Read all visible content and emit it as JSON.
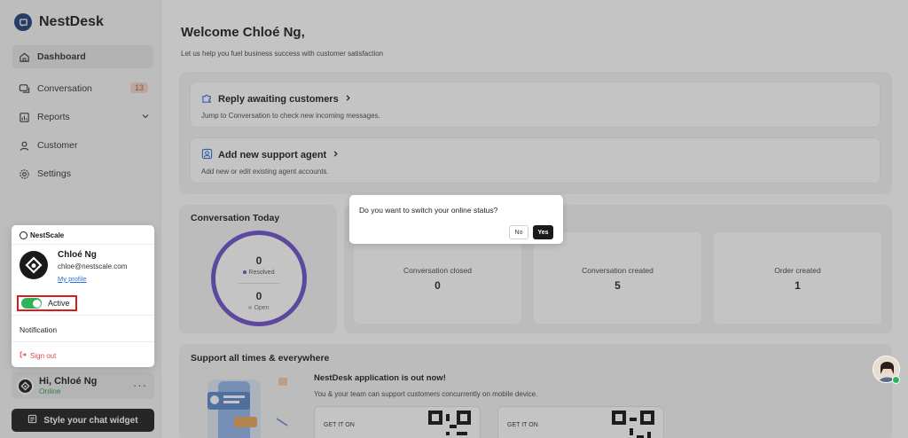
{
  "brand": {
    "name": "NestDesk"
  },
  "sidebar": {
    "items": [
      {
        "label": "Dashboard",
        "icon": "home-icon"
      },
      {
        "label": "Conversation",
        "icon": "chat-icon",
        "badge": "13"
      },
      {
        "label": "Reports",
        "icon": "report-icon"
      },
      {
        "label": "Customer",
        "icon": "user-icon"
      },
      {
        "label": "Settings",
        "icon": "gear-icon"
      }
    ],
    "profile": {
      "name": "Hi, Chloé Ng",
      "status": "Online",
      "more": "···"
    },
    "widget_button": "Style your chat widget"
  },
  "main": {
    "welcome": "Welcome Chloé Ng,",
    "subtitle": "Let us help you fuel business success with customer satisfaction",
    "quick": [
      {
        "title": "Reply awaiting customers",
        "desc": "Jump to Conversation to check new incoming messages."
      },
      {
        "title": "Add new support agent",
        "desc": "Add new or edit existing agent accounts."
      }
    ],
    "conversation_today": {
      "title": "Conversation Today",
      "resolved_value": "0",
      "resolved_label": "Resolved",
      "open_value": "0",
      "open_label": "Open"
    },
    "stats": [
      {
        "label": "Conversation closed",
        "value": "0"
      },
      {
        "label": "Conversation created",
        "value": "5"
      },
      {
        "label": "Order created",
        "value": "1"
      }
    ],
    "support": {
      "title": "Support all times & everywhere",
      "app_title": "NestDesk application is out now!",
      "app_desc": "You & your team can support customers concurrently on mobile device.",
      "store1": "GET IT ON",
      "store2": "GET IT ON"
    }
  },
  "dialog": {
    "question": "Do you want to switch your online status?",
    "no": "No",
    "yes": "Yes"
  },
  "popover": {
    "brand": "NestScale",
    "name": "Chloé Ng",
    "email": "chloe@nestscale.com",
    "profile_link": "My profile",
    "toggle_label": "Active",
    "toggle_on": true,
    "notification": "Notification",
    "sign_out": "Sign out"
  },
  "colors": {
    "accent_purple": "#6a4fc7",
    "online_green": "#2fb25a",
    "highlight_red": "#d81b1b",
    "brand_blue": "#1d3f77"
  }
}
